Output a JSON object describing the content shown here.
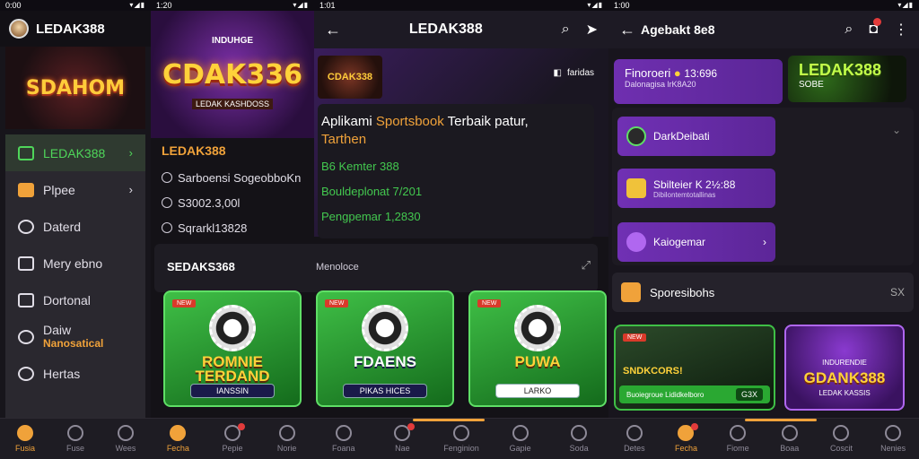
{
  "colors": {
    "accent": "#f0a23a",
    "purple": "#6f2fb0",
    "green": "#43c84f",
    "notif": "#e23b3b"
  },
  "s1": {
    "status_time": "0:00",
    "title": "LEDAK388",
    "logo_text": "SDAHOM",
    "menu": [
      {
        "label": "LEDAK388",
        "icon": "ticket-icon",
        "active": true
      },
      {
        "label": "Plpee",
        "icon": "card-icon"
      },
      {
        "label": "Daterd",
        "icon": "globe-icon"
      },
      {
        "label": "Mery ebno",
        "icon": "briefcase-icon"
      },
      {
        "label": "Dortonal",
        "icon": "document-icon"
      },
      {
        "label": "Daiw",
        "sub": "Nanosatical",
        "icon": "refresh-icon"
      },
      {
        "label": "Hertas",
        "icon": "gear-icon"
      }
    ]
  },
  "s2": {
    "status_time": "1:20",
    "banner_sub": "INDUHGE",
    "banner_title": "CDAK336",
    "banner_sub2": "LEDAK KASHDOSS",
    "brand": "LEDAK388",
    "rows": [
      "Sarboensi SogeobboKn",
      "S3002.3,00l",
      "Sqrarkl13828"
    ]
  },
  "s3": {
    "status_time": "1:01",
    "title": "LEDAK388",
    "hero_logo": "CDAK338",
    "hero_badge": "faridas",
    "hero_title_pre": "Aplikami ",
    "hero_title_hl": "Sportsbook",
    "hero_title_post": " Terbaik patur,",
    "hero_title_line2": "Tarthen",
    "rows": [
      "B6 Kemter 388",
      "Bouldeplonat 7/201",
      "Pengpemar 1,2830"
    ],
    "section_label": "SEDAKS368",
    "section_label2": "Menoloce",
    "cards": [
      {
        "tag": "NEW",
        "title": "ROMNIE TERDAND",
        "button": "IANSSIN"
      },
      {
        "tag": "NEW",
        "title": "FDAENS",
        "button": "PIKAS HICES"
      },
      {
        "tag": "NEW",
        "title": "PUWA",
        "button": "LARKO"
      }
    ]
  },
  "s4": {
    "status_time": "1:00",
    "title": "Agebakt 8e8",
    "promo_title": "Finoroeri",
    "promo_amount": "13:696",
    "promo_sub": "Dalonagisa lrK8A20",
    "ad_title": "LEDAK388",
    "ad_sub": "SOBE",
    "list": [
      {
        "label": "DarkDeibati"
      },
      {
        "label": "Sbilteier K 2½:88",
        "sub": "Dibilontemtotallinas"
      },
      {
        "label": "Kaiogemar"
      }
    ],
    "sports_label": "Sporesibohs",
    "sports_badge": "SX",
    "card_a_tag": "NEW",
    "card_a_title": "SNDKCORS!",
    "card_a_bar": "Buoiegroue Lididkelboro",
    "card_a_btn": "G3X",
    "card_b_sub": "INDURENDIE",
    "card_b_title": "GDANK388",
    "card_b_sub2": "LEDAK KASSIS"
  },
  "nav1": [
    "Fusia",
    "Fuse",
    "Wees",
    "Fecha",
    "Pepie",
    "Norie",
    "Foana",
    "Nae",
    "Fenginion",
    "Gapie",
    "Soda",
    "Detes",
    "Fecha",
    "Fiome",
    "Boaa",
    "Coscit",
    "Nenies"
  ]
}
